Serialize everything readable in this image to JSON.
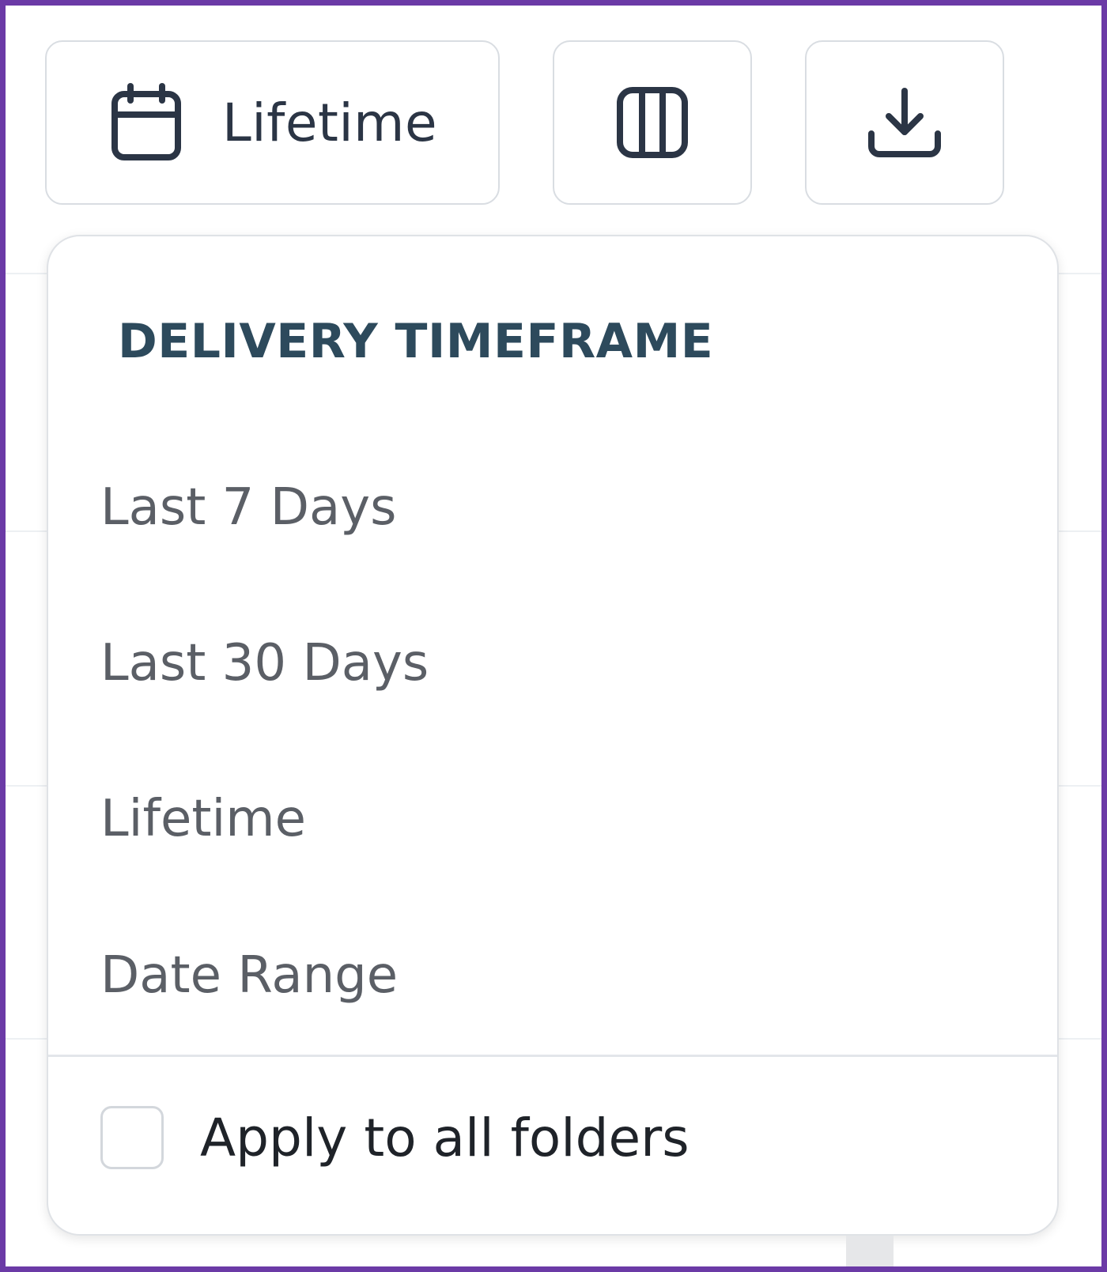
{
  "toolbar": {
    "timeframe_button": {
      "label": "Lifetime",
      "icon": "calendar-icon"
    },
    "columns_button": {
      "icon": "columns-icon"
    },
    "download_button": {
      "icon": "download-icon"
    }
  },
  "dropdown": {
    "heading": "DELIVERY TIMEFRAME",
    "options": [
      {
        "label": "Last 7 Days"
      },
      {
        "label": "Last 30 Days"
      },
      {
        "label": "Lifetime"
      },
      {
        "label": "Date Range"
      }
    ],
    "apply_all": {
      "label": "Apply to all folders",
      "checked": false
    }
  },
  "colors": {
    "frame": "#6b3aa6",
    "heading": "#2d4a5c",
    "option_text": "#5b5f66",
    "icon": "#2b3545",
    "border": "#d9dde2"
  }
}
